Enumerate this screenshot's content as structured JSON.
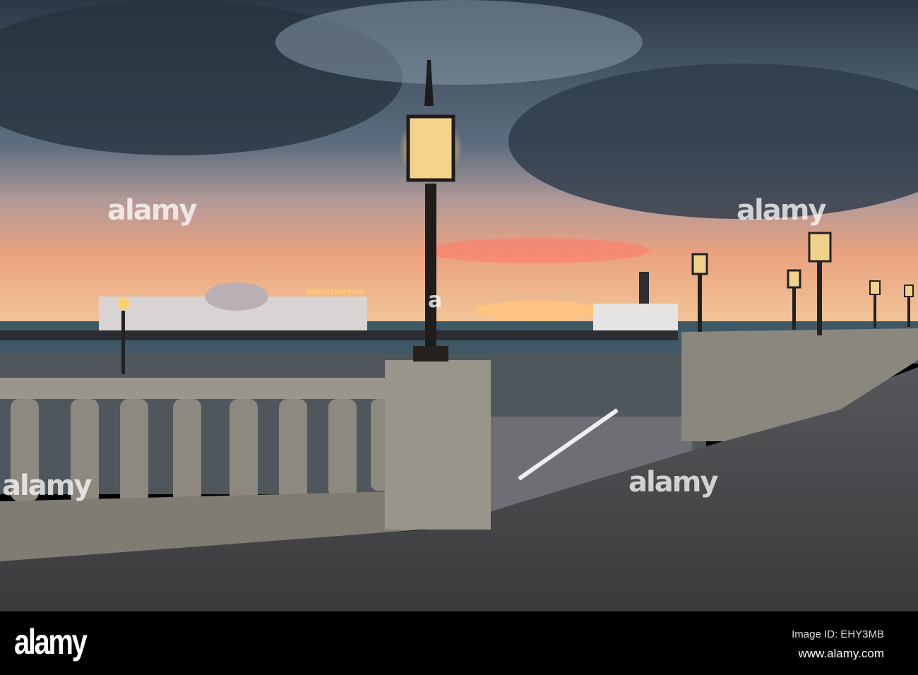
{
  "photo": {
    "subject": "Brighton seafront promenade at sunset",
    "pier_sign": "BRIGHTON PIER",
    "watermark": "alamy",
    "watermark_small": "a"
  },
  "footer": {
    "logo": "alamy",
    "image_id": "Image ID: EHY3MB",
    "website": "www.alamy.com"
  },
  "colors": {
    "sky_dark": "#2f3d4c",
    "sunset": "#f08a6a",
    "deck": "#4a4a4c",
    "stone": "#8e8b83"
  }
}
